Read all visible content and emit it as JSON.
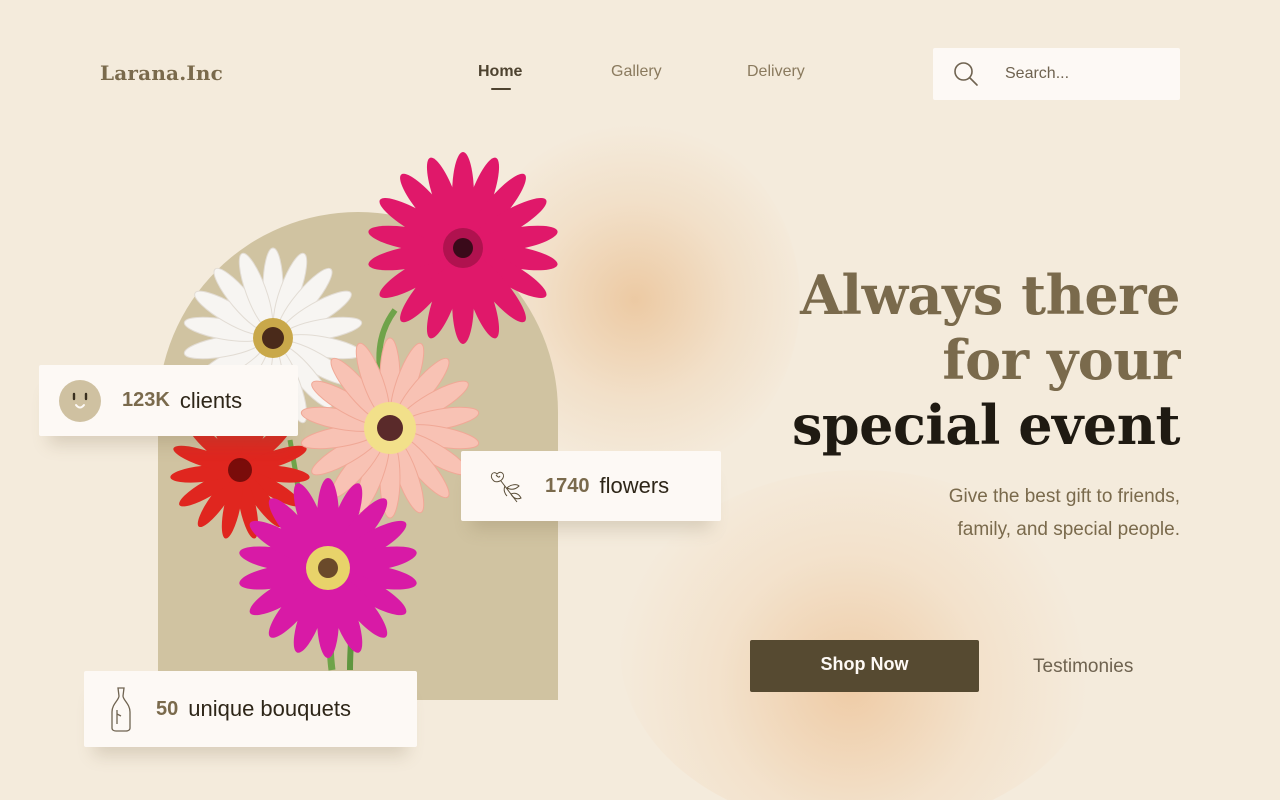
{
  "brand": {
    "logo": "Larana.Inc"
  },
  "nav": {
    "items": [
      {
        "label": "Home",
        "active": true
      },
      {
        "label": "Gallery",
        "active": false
      },
      {
        "label": "Delivery",
        "active": false
      }
    ]
  },
  "search": {
    "placeholder": "Search...",
    "icon": "search-icon"
  },
  "stats": {
    "clients": {
      "value": "123K",
      "label": "clients",
      "icon": "smiley-icon"
    },
    "flowers": {
      "value": "1740",
      "label": "flowers",
      "icon": "flower-sketch-icon"
    },
    "bouquets": {
      "value": "50",
      "label": "unique bouquets",
      "icon": "vase-icon"
    }
  },
  "hero": {
    "line1": "Always there",
    "line2": "for your",
    "line3": "special event",
    "subtitle_line1": "Give the best gift to friends,",
    "subtitle_line2": "family, and special people."
  },
  "cta": {
    "primary": "Shop Now",
    "secondary": "Testimonies"
  },
  "colors": {
    "background": "#f4ebdc",
    "accent": "#7a6a4c",
    "button": "#564a31",
    "arch": "#d0c3a1"
  }
}
